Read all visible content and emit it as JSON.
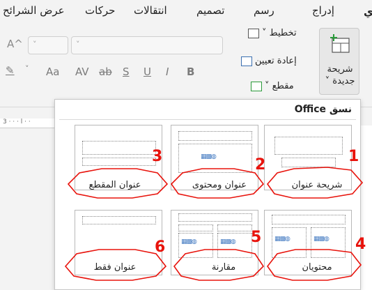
{
  "ribbon_tabs": [
    "عرض الشرائح",
    "حركات",
    "انتقالات",
    "تصميم",
    "رسم",
    "إدراج"
  ],
  "active_tab_mark": "ي",
  "ribbon": {
    "new_slide_label_line1": "شريحة",
    "new_slide_label_line2": "جديدة ˅",
    "layout_label": "تخطيط ˅",
    "reset_label": "إعادة تعيين",
    "section_label": "مقطع ˅",
    "font_grow": "A^",
    "format_buttons": [
      "B",
      "I",
      "U",
      "S",
      "ab",
      "AV",
      "Aa"
    ]
  },
  "ruler_text": "3 · · · l · ·",
  "dropdown": {
    "header": "نسق Office",
    "layouts": [
      {
        "number": "1",
        "label": "شريحة عنوان"
      },
      {
        "number": "2",
        "label": "عنوان ومحتوى"
      },
      {
        "number": "3",
        "label": "عنوان المقطع"
      },
      {
        "number": "4",
        "label": "محتويان"
      },
      {
        "number": "5",
        "label": "مقارنة"
      },
      {
        "number": "6",
        "label": "عنوان فقط"
      }
    ]
  },
  "colors": {
    "annotation": "#e8130c",
    "accent_green": "#2a9a3a"
  }
}
